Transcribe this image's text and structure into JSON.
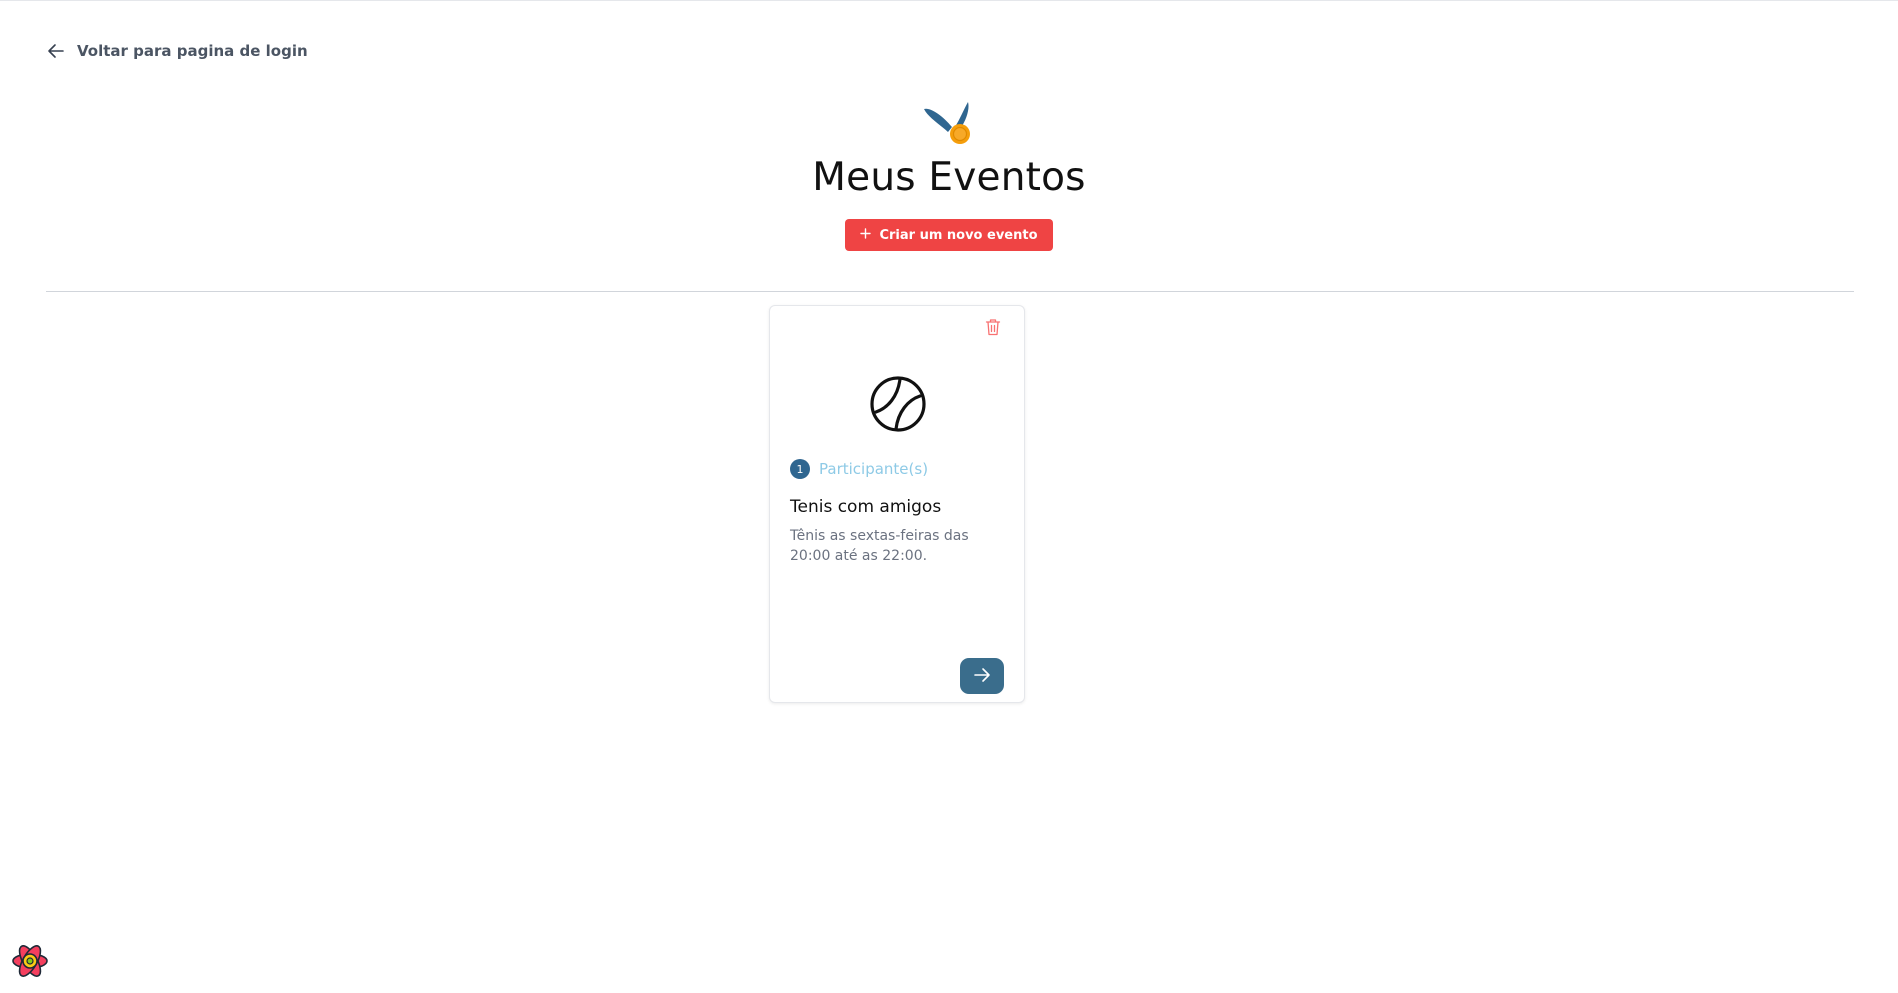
{
  "back_link": {
    "label": "Voltar para pagina de login",
    "icon": "arrow-left-icon"
  },
  "header": {
    "logo_icon": "medal-icon",
    "title": "Meus Eventos",
    "new_event_button": {
      "icon": "plus-icon",
      "label": "Criar um novo evento"
    }
  },
  "events": [
    {
      "sport_icon": "tennis-ball-icon",
      "participants_count": "1",
      "participants_label": "Participante(s)",
      "title": "Tenis com amigos",
      "description": "Tênis as sextas-feiras das 20:00 até as 22:00.",
      "delete_icon": "trash-icon",
      "open_icon": "arrow-right-icon"
    }
  ],
  "devtools": {
    "icon": "react-query-devtools-icon"
  },
  "colors": {
    "accent_red": "#ef4444",
    "primary_blue": "#3a6d8c",
    "participants_label": "#8ecae6",
    "medal_gold": "#f59e0b"
  }
}
